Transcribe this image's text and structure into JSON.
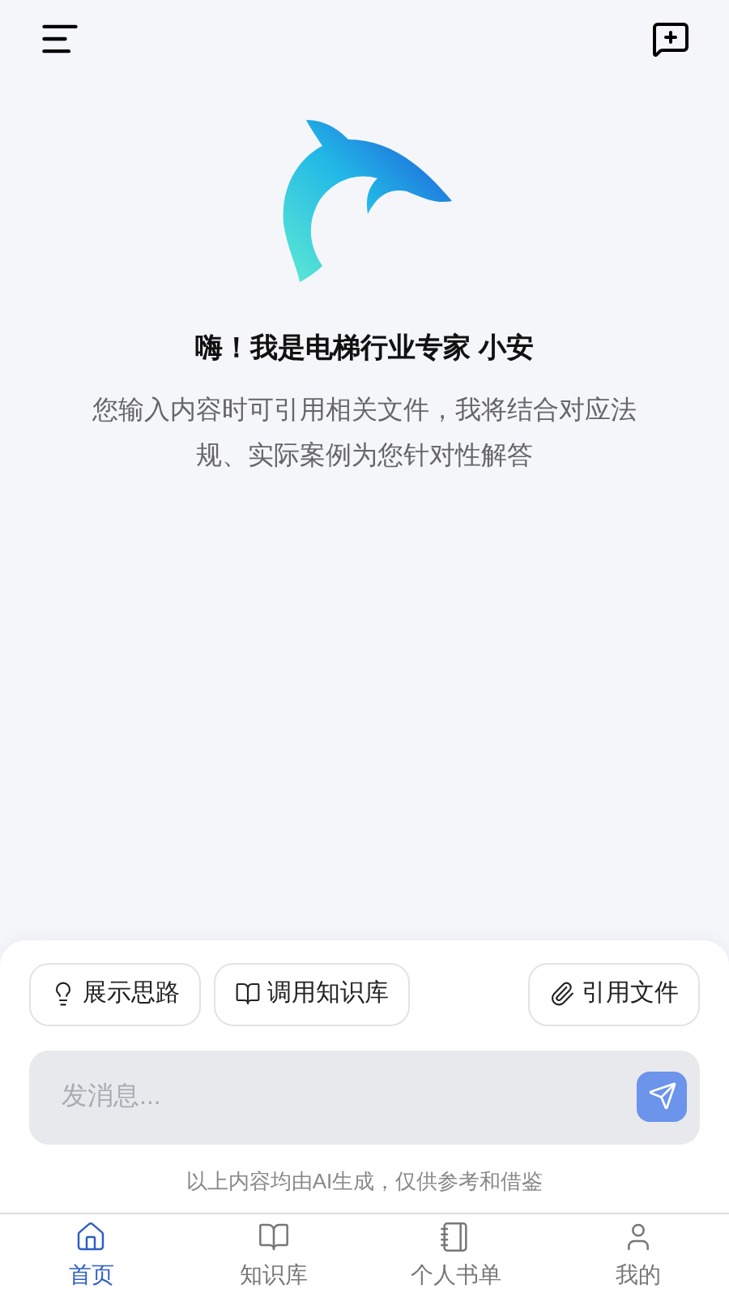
{
  "greeting": {
    "title": "嗨！我是电梯行业专家 小安",
    "subtitle": "您输入内容时可引用相关文件，我将结合对应法规、实际案例为您针对性解答"
  },
  "options": [
    {
      "kind": "bulb",
      "label": "展示思路",
      "selected": false
    },
    {
      "kind": "book",
      "label": "调用知识库",
      "selected": false
    },
    {
      "kind": "clip",
      "label": "引用文件",
      "selected": false
    }
  ],
  "composer": {
    "placeholder": "发消息..."
  },
  "disclaimer": "以上内容均由AI生成，仅供参考和借鉴",
  "nav": [
    {
      "kind": "home",
      "label": "首页",
      "selected": true
    },
    {
      "kind": "book",
      "label": "知识库",
      "selected": false
    },
    {
      "kind": "notebook",
      "label": "个人书单",
      "selected": false
    },
    {
      "kind": "user",
      "label": "我的",
      "selected": false
    }
  ]
}
